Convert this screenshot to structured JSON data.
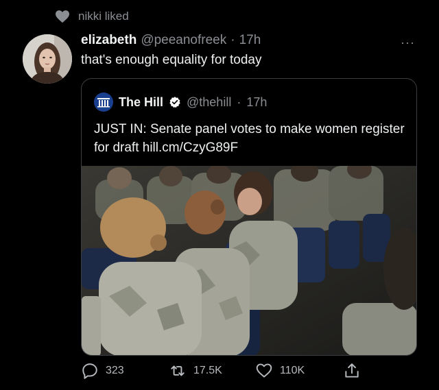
{
  "activity": {
    "text": "nikki liked",
    "icon": "heart-icon"
  },
  "tweet": {
    "author_name": "elizabeth",
    "author_handle": "@peeanofreek",
    "separator": "·",
    "time": "17h",
    "text": "that's enough equality for today",
    "more_icon": "more-dots-icon",
    "more_label": "···"
  },
  "quoted_tweet": {
    "logo_icon": "the-hill-logo-icon",
    "author_name": "The Hill",
    "verified_icon": "verified-badge-icon",
    "author_handle": "@thehill",
    "separator": "·",
    "time": "17h",
    "text": "JUST IN: Senate panel votes to make women register for draft hill.cm/CzyG89F",
    "image": "photo of seated soldiers in camouflage uniforms"
  },
  "actions": [
    {
      "icon": "reply-icon",
      "count": "323"
    },
    {
      "icon": "retweet-icon",
      "count": "17.5K"
    },
    {
      "icon": "like-icon",
      "count": "110K"
    },
    {
      "icon": "share-icon",
      "count": ""
    }
  ],
  "colors": {
    "background": "#000000",
    "text": "#e7e9ea",
    "muted": "#8b8f94",
    "border": "#3a3e42",
    "verified_badge": "#ffffff"
  }
}
